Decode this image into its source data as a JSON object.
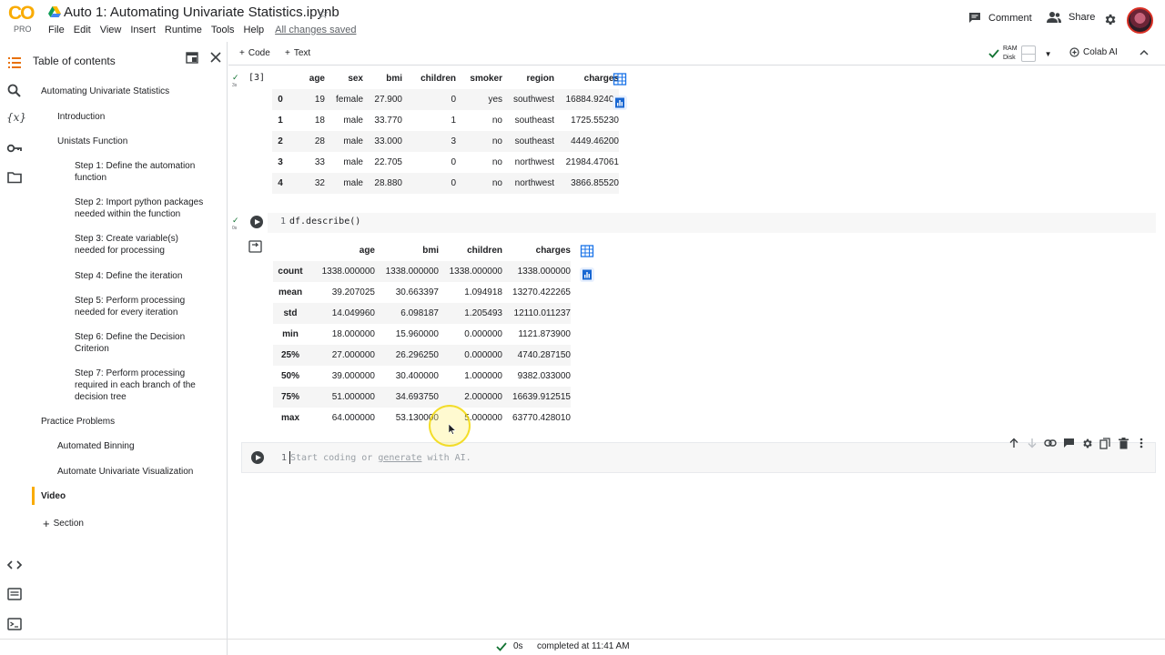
{
  "header": {
    "logo_text": "CO",
    "logo_sub": "PRO",
    "title": "Auto 1: Automating Univariate Statistics.ipynb",
    "menu": [
      "File",
      "Edit",
      "View",
      "Insert",
      "Runtime",
      "Tools",
      "Help"
    ],
    "save_status": "All changes saved",
    "comment_label": "Comment",
    "share_label": "Share"
  },
  "sidebar": {
    "title": "Table of contents",
    "items": [
      {
        "label": "Automating Univariate Statistics"
      },
      {
        "label": "Introduction"
      },
      {
        "label": "Unistats Function"
      },
      {
        "label": "Step 1: Define the automation function"
      },
      {
        "label": "Step 2: Import python packages needed within the function"
      },
      {
        "label": "Step 3: Create variable(s) needed for processing"
      },
      {
        "label": "Step 4: Define the iteration"
      },
      {
        "label": "Step 5: Perform processing needed for every iteration"
      },
      {
        "label": "Step 6: Define the Decision Criterion"
      },
      {
        "label": "Step 7: Perform processing required in each branch of the decision tree"
      },
      {
        "label": "Practice Problems"
      },
      {
        "label": "Automated Binning"
      },
      {
        "label": "Automate Univariate Visualization"
      },
      {
        "label": "Video"
      }
    ],
    "add_section": "Section"
  },
  "toolbar": {
    "code_label": "Code",
    "text_label": "Text",
    "ram_label": "RAM",
    "disk_label": "Disk",
    "colab_ai_label": "Colab AI"
  },
  "cell1": {
    "exec_count": "[3]",
    "time": "3s",
    "columns": [
      "",
      "age",
      "sex",
      "bmi",
      "children",
      "smoker",
      "region",
      "charges"
    ],
    "rows": [
      [
        "0",
        "19",
        "female",
        "27.900",
        "0",
        "yes",
        "southwest",
        "16884.92400"
      ],
      [
        "1",
        "18",
        "male",
        "33.770",
        "1",
        "no",
        "southeast",
        "1725.55230"
      ],
      [
        "2",
        "28",
        "male",
        "33.000",
        "3",
        "no",
        "southeast",
        "4449.46200"
      ],
      [
        "3",
        "33",
        "male",
        "22.705",
        "0",
        "no",
        "northwest",
        "21984.47061"
      ],
      [
        "4",
        "32",
        "male",
        "28.880",
        "0",
        "no",
        "northwest",
        "3866.85520"
      ]
    ]
  },
  "cell2": {
    "line_no": "1",
    "code": "df.describe()",
    "time": "0s",
    "columns": [
      "",
      "age",
      "bmi",
      "children",
      "charges"
    ],
    "rows": [
      [
        "count",
        "1338.000000",
        "1338.000000",
        "1338.000000",
        "1338.000000"
      ],
      [
        "mean",
        "39.207025",
        "30.663397",
        "1.094918",
        "13270.422265"
      ],
      [
        "std",
        "14.049960",
        "6.098187",
        "1.205493",
        "12110.011237"
      ],
      [
        "min",
        "18.000000",
        "15.960000",
        "0.000000",
        "1121.873900"
      ],
      [
        "25%",
        "27.000000",
        "26.296250",
        "0.000000",
        "4740.287150"
      ],
      [
        "50%",
        "39.000000",
        "30.400000",
        "1.000000",
        "9382.033000"
      ],
      [
        "75%",
        "51.000000",
        "34.693750",
        "2.000000",
        "16639.912515"
      ],
      [
        "max",
        "64.000000",
        "53.130000",
        "5.000000",
        "63770.428010"
      ]
    ]
  },
  "cell3": {
    "line_no": "1",
    "placeholder_a": "Start coding or ",
    "placeholder_link": "generate",
    "placeholder_b": " with AI."
  },
  "status": {
    "time": "0s",
    "text": "completed at 11:41 AM"
  },
  "colors": {
    "accent": "#f9ab00",
    "link": "#1a73e8",
    "success": "#137333"
  }
}
